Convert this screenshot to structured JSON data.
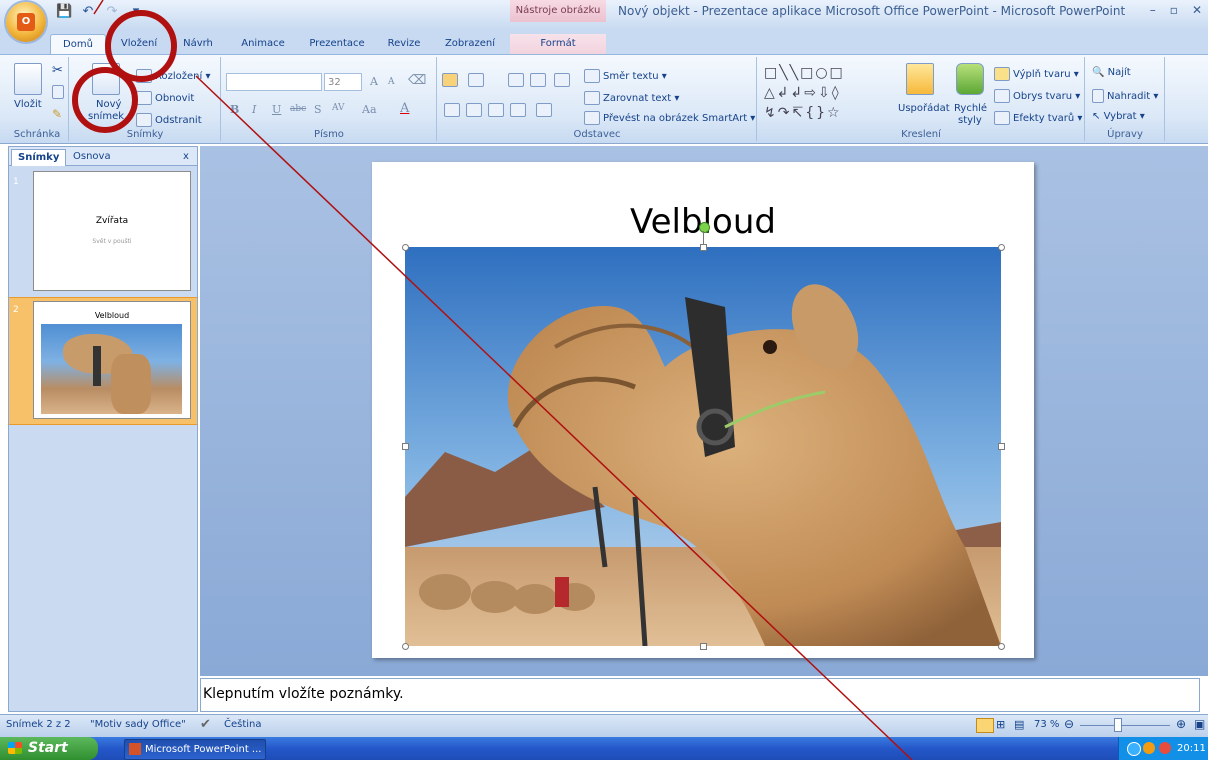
{
  "window": {
    "title": "Nový objekt - Prezentace aplikace Microsoft Office PowerPoint - Microsoft PowerPoint",
    "contextual_tab_group": "Nástroje obrázku",
    "controls": {
      "minimize": "–",
      "restore": "▫",
      "close": "✕"
    }
  },
  "office_button": {
    "label": "O"
  },
  "tabs": [
    {
      "label": "Domů",
      "active": true
    },
    {
      "label": "Vložení"
    },
    {
      "label": "Návrh"
    },
    {
      "label": "Animace"
    },
    {
      "label": "Prezentace"
    },
    {
      "label": "Revize"
    },
    {
      "label": "Zobrazení"
    },
    {
      "label": "Formát",
      "contextual": true
    }
  ],
  "ribbon": {
    "clipboard": {
      "group_label": "Schránka",
      "paste": "Vložit"
    },
    "slides": {
      "group_label": "Snímky",
      "new_slide_1": "Nový",
      "new_slide_2": "snímek",
      "layout": "Rozložení",
      "reset": "Obnovit",
      "delete": "Odstranit"
    },
    "font": {
      "group_label": "Písmo",
      "size": "32",
      "bold": "B",
      "italic": "I",
      "underline": "U",
      "strike": "abc",
      "shadow": "S",
      "spacing": "AV",
      "case": "Aa",
      "color": "A",
      "grow": "A",
      "shrink": "A"
    },
    "paragraph": {
      "group_label": "Odstavec",
      "text_direction": "Směr textu",
      "align_text": "Zarovnat text",
      "smartart": "Převést na obrázek SmartArt"
    },
    "drawing": {
      "group_label": "Kreslení",
      "arrange": "Uspořádat",
      "quick_styles_1": "Rychlé",
      "quick_styles_2": "styly",
      "shape_fill": "Výplň tvaru",
      "shape_outline": "Obrys tvaru",
      "shape_effects": "Efekty tvarů"
    },
    "editing": {
      "group_label": "Úpravy",
      "find": "Najít",
      "replace": "Nahradit",
      "select": "Vybrat"
    }
  },
  "left_panel": {
    "tab_slides": "Snímky",
    "tab_outline": "Osnova",
    "close": "x",
    "thumbnails": [
      {
        "number": "1",
        "title": "Zvířata",
        "subtitle": "Svět v poušti"
      },
      {
        "number": "2",
        "title": "Velbloud"
      }
    ]
  },
  "slide": {
    "title": "Velbloud"
  },
  "notes": {
    "placeholder": "Klepnutím vložíte poznámky."
  },
  "status": {
    "slide": "Snímek 2 z 2",
    "theme": "\"Motiv sady Office\"",
    "language": "Čeština",
    "zoom": "73 %"
  },
  "taskbar": {
    "start": "Start",
    "item": "Microsoft PowerPoint ...",
    "clock": "20:11"
  },
  "colors": {
    "annotation": "#b01010",
    "ribbon_text": "#15428b"
  }
}
